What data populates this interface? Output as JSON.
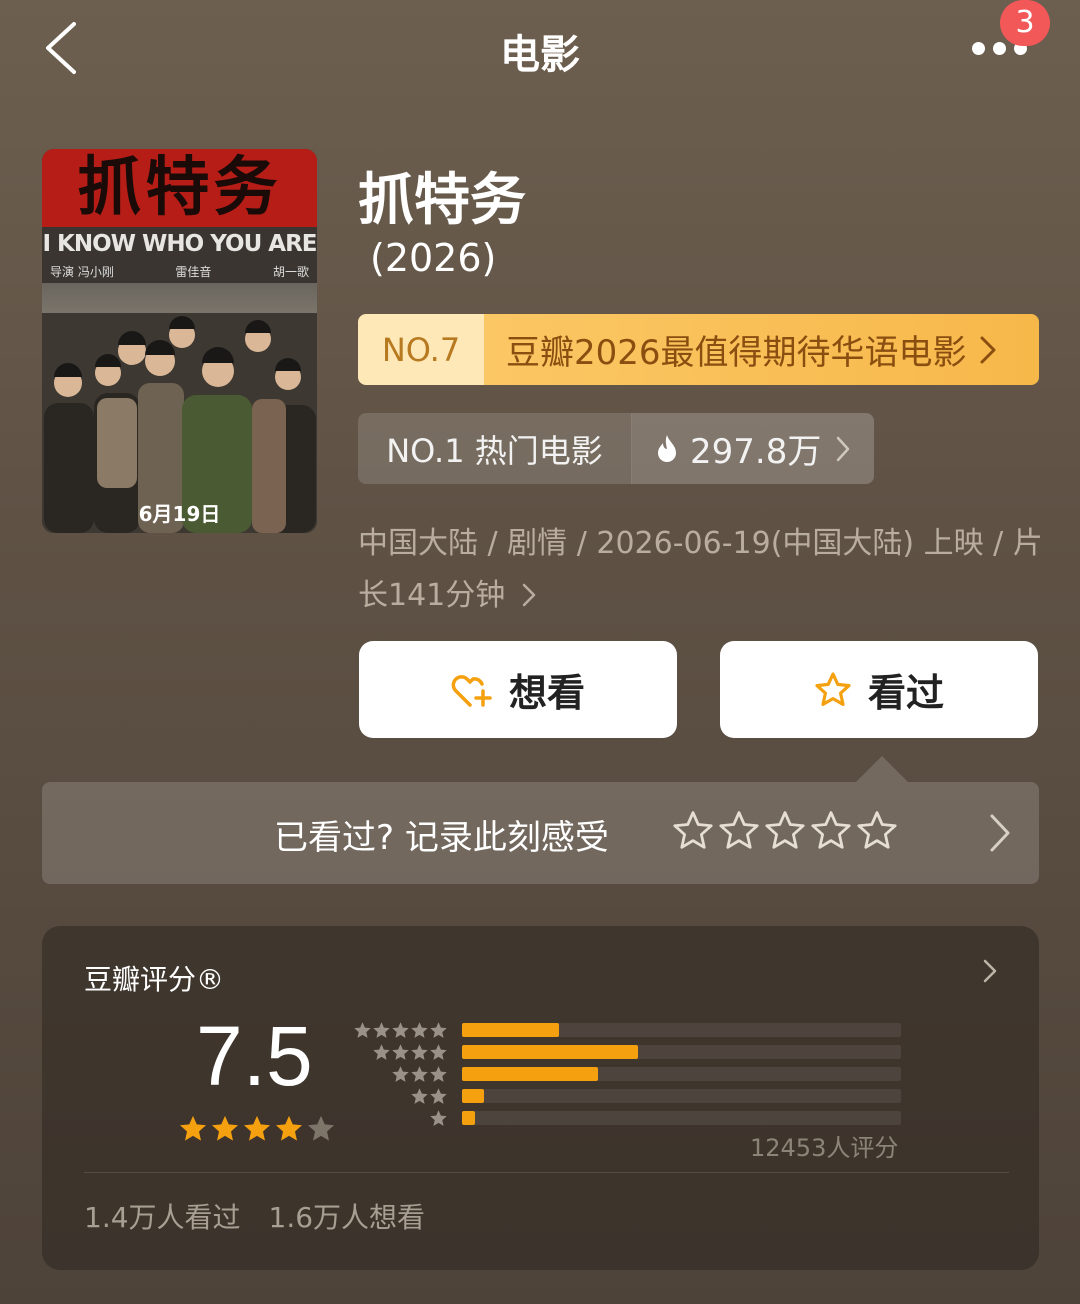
{
  "header": {
    "title": "电影",
    "badge_count": "3"
  },
  "poster": {
    "title": "抓特务",
    "english_title": "I KNOW WHO YOU ARE",
    "director_credit": "导演 冯小刚",
    "cast_credit_1": "雷佳音",
    "cast_credit_2": "胡一歌",
    "release_date": "6月19日"
  },
  "movie": {
    "title": "抓特务",
    "year": "(2026)"
  },
  "rank_banner": {
    "rank": "NO.7",
    "text": "豆瓣2026最值得期待华语电影"
  },
  "hot_banner": {
    "rank": "NO.1 热门电影",
    "count": "297.8万"
  },
  "info": {
    "text": "中国大陆 / 剧情 / 2026-06-19(中国大陆) 上映 / 片长141分钟"
  },
  "actions": {
    "want_label": "想看",
    "seen_label": "看过"
  },
  "record": {
    "text": "已看过? 记录此刻感受",
    "star_count": 5
  },
  "rating": {
    "label": "豆瓣评分®",
    "score": "7.5",
    "stars_filled": 4,
    "distribution": [
      {
        "stars": 5,
        "fraction": 0.22
      },
      {
        "stars": 4,
        "fraction": 0.4
      },
      {
        "stars": 3,
        "fraction": 0.31
      },
      {
        "stars": 2,
        "fraction": 0.05
      },
      {
        "stars": 1,
        "fraction": 0.03
      }
    ],
    "votes": "12453人评分",
    "watched": "1.4万人看过",
    "want": "1.6万人想看"
  },
  "colors": {
    "accent_orange": "#f5a00f",
    "rank_gold": "#fbc764",
    "badge_red": "#f25858"
  }
}
